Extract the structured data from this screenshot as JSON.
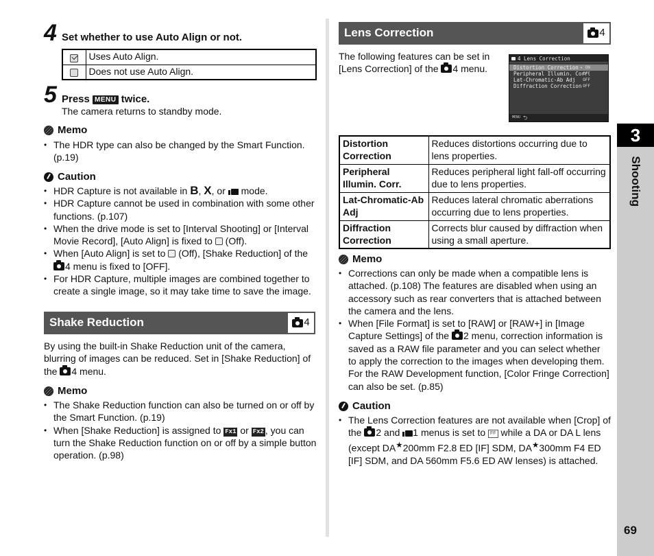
{
  "step4": {
    "number": "4",
    "title": "Set whether to use Auto Align or not.",
    "options": [
      {
        "icon": "auto-align-on-icon",
        "label": "Uses Auto Align."
      },
      {
        "icon": "auto-align-off-icon",
        "label": "Does not use Auto Align."
      }
    ]
  },
  "step5": {
    "number": "5",
    "title_prefix": "Press",
    "key": "MENU",
    "title_suffix": "twice.",
    "description": "The camera returns to standby mode."
  },
  "memo1": {
    "title": "Memo",
    "items": [
      "The HDR type can also be changed by the Smart Function. (p.19)"
    ]
  },
  "caution1": {
    "title": "Caution",
    "items": {
      "i1_a": "HDR Capture is not available in",
      "i1_b": "B",
      "i1_c": ",",
      "i1_d": "X",
      "i1_e": ", or",
      "i1_f": "mode.",
      "i2": "HDR Capture cannot be used in combination with some other functions. (p.107)",
      "i3_a": "When the drive mode is set to [Interval Shooting] or [Interval Movie Record], [Auto Align] is fixed to",
      "i3_b": "(Off).",
      "i4_a": "When [Auto Align] is set to",
      "i4_b": "(Off), [Shake Reduction] of the",
      "i4_c": "4 menu is fixed to [OFF].",
      "i5": "For HDR Capture, multiple images are combined together to create a single image, so it may take time to save the image."
    }
  },
  "shake_reduction": {
    "header": "Shake Reduction",
    "menu_ref": "4",
    "para_a": "By using the built-in Shake Reduction unit of the camera, blurring of images can be reduced. Set in [Shake Reduction] of the",
    "para_b": "4 menu.",
    "memo": {
      "title": "Memo",
      "i1": "The Shake Reduction function can also be turned on or off by the Smart Function. (p.19)",
      "i2_a": "When [Shake Reduction] is assigned to",
      "i2_key1": "Fx1",
      "i2_b": "or",
      "i2_key2": "Fx2",
      "i2_c": ", you can turn the Shake Reduction function on or off by a simple button operation. (p.98)"
    }
  },
  "lens_correction": {
    "header": "Lens Correction",
    "menu_ref": "4",
    "intro_a": "The following features can be set in [Lens Correction] of the",
    "intro_b": "4 menu.",
    "screen": {
      "title": "4 Lens Correction",
      "items": [
        {
          "label": "Distortion Correction",
          "value": "▸ ON",
          "selected": true
        },
        {
          "label": "Peripheral Illumin. Corr.",
          "value": "OFF",
          "selected": false
        },
        {
          "label": "Lat-Chromatic-Ab Adj",
          "value": "OFF",
          "selected": false
        },
        {
          "label": "Diffraction Correction",
          "value": "OFF",
          "selected": false
        }
      ],
      "footer_key": "MENU",
      "footer_icon": "back-arrow-icon"
    },
    "features": [
      {
        "name": "Distortion Correction",
        "desc": "Reduces distortions occurring due to lens properties."
      },
      {
        "name": "Peripheral Illumin. Corr.",
        "desc": "Reduces peripheral light fall-off occurring due to lens properties."
      },
      {
        "name": "Lat-Chromatic-Ab Adj",
        "desc": "Reduces lateral chromatic aberrations occurring due to lens properties."
      },
      {
        "name": "Diffraction Correction",
        "desc": "Corrects blur caused by diffraction when using a small aperture."
      }
    ],
    "memo": {
      "title": "Memo",
      "i1": "Corrections can only be made when a compatible lens is attached. (p.108) The features are disabled when using an accessory such as rear converters that is attached between the camera and the lens.",
      "i2_a": "When [File Format] is set to [RAW] or [RAW+] in [Image Capture Settings] of the",
      "i2_b": "2 menu, correction information is saved as a RAW file parameter and you can select whether to apply the correction to the images when developing them. For the RAW Development function, [Color Fringe Correction] can also be set. (p.85)"
    },
    "caution": {
      "title": "Caution",
      "a": "The Lens Correction features are not available when [Crop] of the",
      "b": "2 and",
      "c": "1 menus is set to",
      "ff": "FF",
      "d": "while a DA or DA L lens (except DA",
      "star": "★",
      "e": "200mm F2.8 ED [IF] SDM, DA",
      "f": "300mm F4 ED [IF] SDM, and DA 560mm F5.6 ED AW lenses) is attached."
    }
  },
  "side_tab": {
    "chapter_number": "3",
    "chapter_name": "Shooting",
    "page_number": "69"
  },
  "colors": {
    "section_header_bg": "#555555",
    "side_tab_bg": "#cccccc",
    "chapter_tab_bg": "#000000"
  }
}
